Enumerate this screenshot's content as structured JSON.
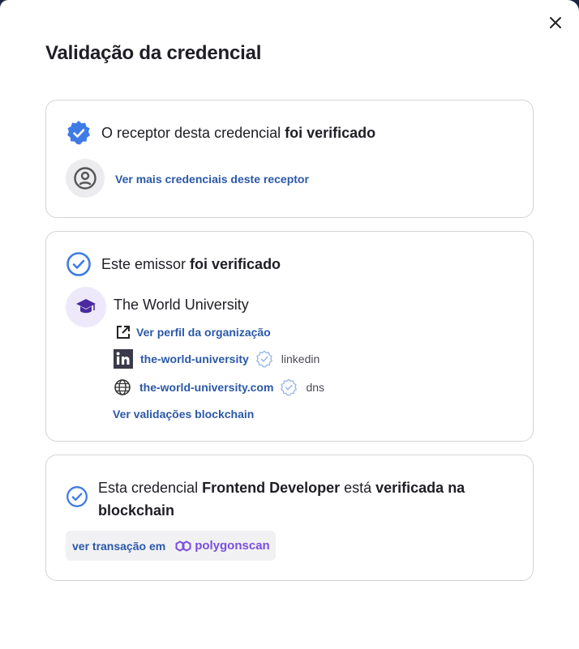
{
  "modal": {
    "title": "Validação da credencial",
    "close_icon": "close-icon"
  },
  "receptor_card": {
    "heading_prefix": "O receptor desta credencial ",
    "heading_bold": "foi verificado",
    "more_credentials_link": "Ver mais credenciais deste receptor"
  },
  "issuer_card": {
    "heading_prefix": "Este emissor ",
    "heading_bold": "foi verificado",
    "org_name": "The World University",
    "org_profile_link": "Ver perfil da organização",
    "linkedin_handle": "the-world-university",
    "linkedin_label": "linkedin",
    "domain": "the-world-university.com",
    "dns_label": "dns",
    "blockchain_link": "Ver validações blockchain"
  },
  "credential_card": {
    "heading_part1": "Esta credencial ",
    "credential_name": "Frontend Developer",
    "heading_part2": " está ",
    "heading_bold_end": "verificada na blockchain",
    "transaction_label": "ver transação em",
    "polygonscan_label": "polygonscan"
  },
  "colors": {
    "accent_blue": "#3f7be6",
    "link_blue": "#2b58a8",
    "polygon_purple": "#7b4fe0",
    "org_purple": "#4b2aa0"
  }
}
